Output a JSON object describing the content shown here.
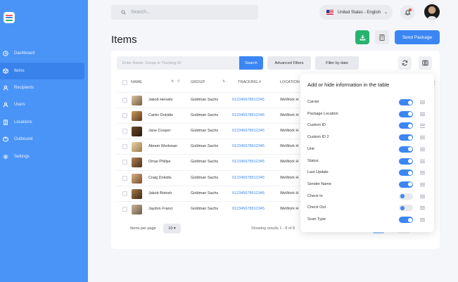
{
  "sidebar": {
    "items": [
      {
        "label": "Dashboard",
        "icon": "clock-icon"
      },
      {
        "label": "Items",
        "icon": "box-icon",
        "active": true
      },
      {
        "label": "Recipients",
        "icon": "user-icon"
      },
      {
        "label": "Users",
        "icon": "user-icon"
      },
      {
        "label": "Locations",
        "icon": "building-icon"
      },
      {
        "label": "Outbound",
        "icon": "package-icon"
      },
      {
        "label": "Settings",
        "icon": "gear-icon"
      }
    ]
  },
  "header": {
    "search_placeholder": "Search...",
    "language": "United States - English"
  },
  "page": {
    "title": "Items",
    "send_label": "Send Package"
  },
  "toolbar": {
    "filter_placeholder": "Enter Name, Group or Tracking ID",
    "search_label": "Search",
    "advanced_label": "Advanced Filters",
    "date_label": "Filter by date"
  },
  "table": {
    "headers": {
      "name": "NAME",
      "group": "GROUP",
      "tracking": "TRACKING #",
      "location": "LOCATION"
    },
    "rows": [
      {
        "name": "Jakob Herwitz",
        "group": "Goldman Sachs",
        "tracking": "012345678912345",
        "location": "WeWork H"
      },
      {
        "name": "Carter Dokidis",
        "group": "Goldman Sachs",
        "tracking": "012345678912345",
        "location": "WeWork H"
      },
      {
        "name": "Jane Cooper",
        "group": "Goldman Sachs",
        "tracking": "012345678912345",
        "location": "WeWork H"
      },
      {
        "name": "Abram Workman",
        "group": "Goldman Sachs",
        "tracking": "012345678912345",
        "location": "WeWork H"
      },
      {
        "name": "Omar Philips",
        "group": "Goldman Sachs",
        "tracking": "012345678912345",
        "location": "WeWork H"
      },
      {
        "name": "Craig Dokidis",
        "group": "Goldman Sachs",
        "tracking": "012345678912345",
        "location": "WeWork H"
      },
      {
        "name": "Jakob Botosh",
        "group": "Goldman Sachs",
        "tracking": "012345678912345",
        "location": "WeWork H"
      },
      {
        "name": "Jaydon Franci",
        "group": "Goldman Sachs",
        "tracking": "012345678912345",
        "location": "WeWork H"
      }
    ]
  },
  "pagination": {
    "per_page_label": "Items per page",
    "per_page_value": "10 ▾",
    "results_text": "Showing results 1 - 8 of 8"
  },
  "popup": {
    "title": "Add or hide information in the table",
    "options": [
      {
        "label": "Carrier",
        "on": true
      },
      {
        "label": "Package Location",
        "on": true
      },
      {
        "label": "Custom ID",
        "on": true
      },
      {
        "label": "Custom ID 2",
        "on": true
      },
      {
        "label": "Unit",
        "on": true
      },
      {
        "label": "Status",
        "on": true
      },
      {
        "label": "Last Update",
        "on": true
      },
      {
        "label": "Sender Name",
        "on": true
      },
      {
        "label": "Check In",
        "on": false
      },
      {
        "label": "Check Out",
        "on": false
      },
      {
        "label": "Scan Type",
        "on": true
      }
    ]
  },
  "colors": {
    "sidebar": "#4a94f8",
    "accent": "#3b86f3",
    "download": "#27b36f"
  }
}
